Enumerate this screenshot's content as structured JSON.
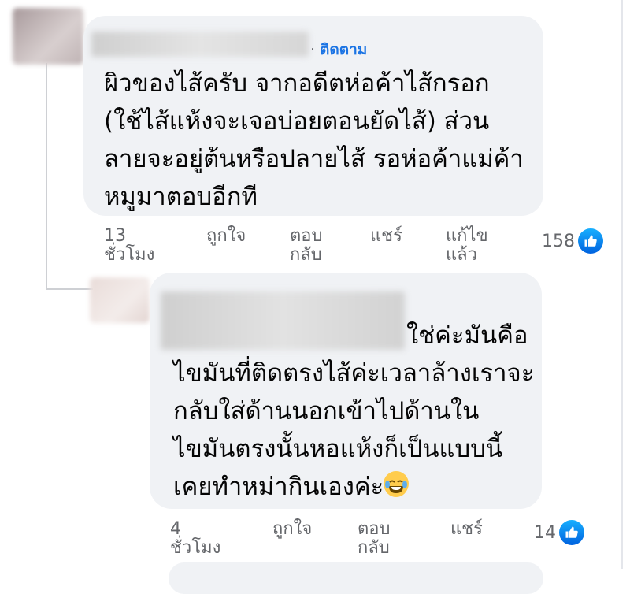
{
  "comments": [
    {
      "follow_label": "ติดตาม",
      "text_lines": [
        "ผิวของไส้ครับ จากอดีตห่อค้าไส้กรอก",
        "(ใช้ไส้แห้งจะเจอบ่อยตอนยัดไส้) ส่วน",
        "ลายจะอยู่ต้นหรือปลายไส้ รอห่อค้าแม่ค้า",
        "หมูมาตอบอีกที"
      ],
      "time": "13\nชั่วโมง",
      "like_label": "ถูกใจ",
      "reply_label": "ตอบ\nกลับ",
      "share_label": "แชร์",
      "edited_label": "แก้ไข\nแล้ว",
      "reaction_count": "158",
      "reaction_icon": "like-icon"
    },
    {
      "text_lines": [
        "ใช่ค่ะมันคือ",
        "ไขมันที่ติดตรงไส้ค่ะเวลาล้างเราจะ",
        "กลับใส่ด้านนอกเข้าไปด้านใน",
        "ไขมันตรงนั้นหอแห้งก็เป็นแบบนี้",
        "เคยทำหม่ากินเองค่ะ"
      ],
      "emoji": "laughing-tears-emoji",
      "time": "4\nชั่วโมง",
      "like_label": "ถูกใจ",
      "reply_label": "ตอบ\nกลับ",
      "share_label": "แชร์",
      "reaction_count": "14",
      "reaction_icon": "like-icon"
    }
  ],
  "colors": {
    "bubble": "#f0f2f5",
    "link": "#1b74e4",
    "meta": "#65676b",
    "like_badge": "#0866ff"
  }
}
